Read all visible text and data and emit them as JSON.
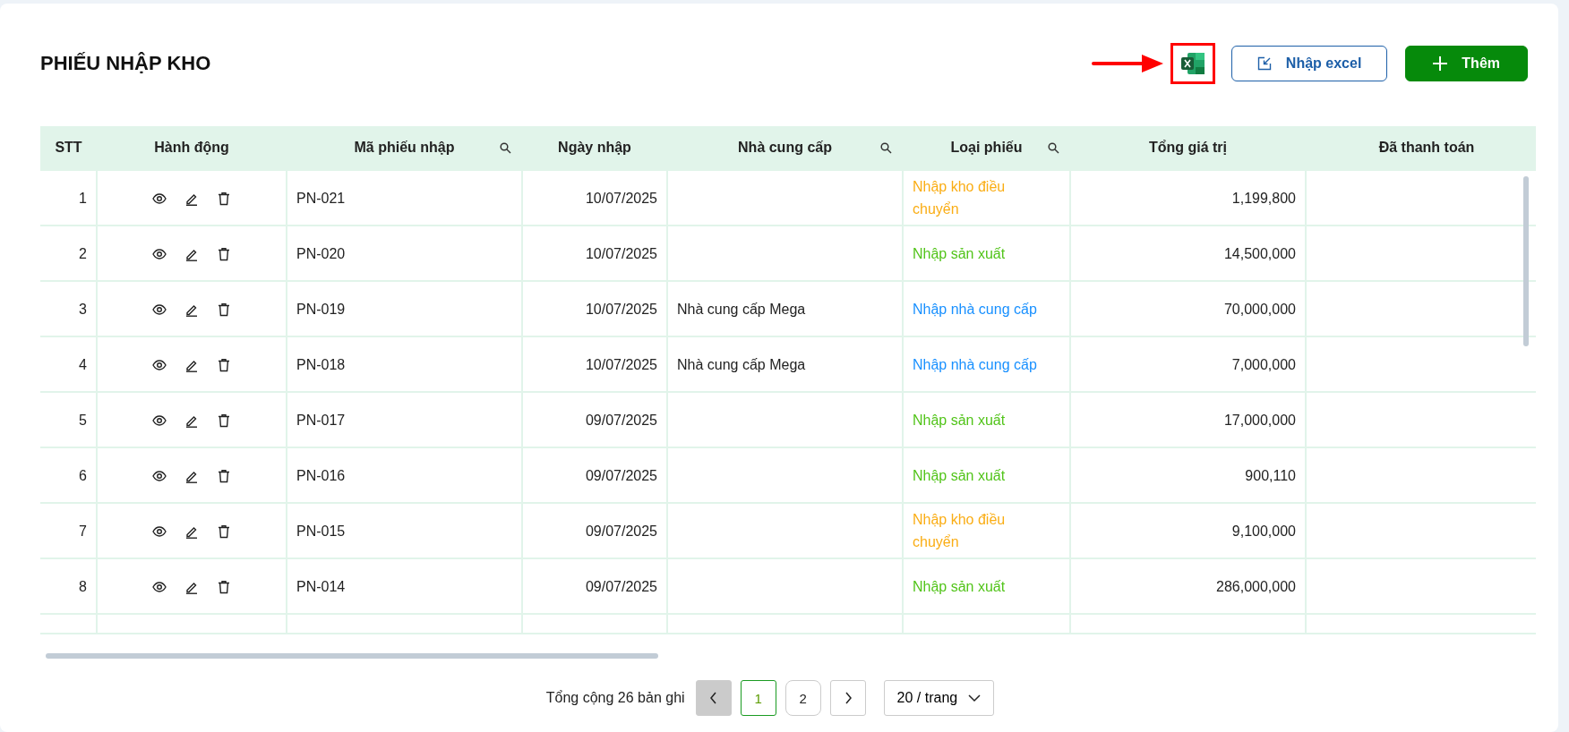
{
  "title": "PHIẾU NHẬP KHO",
  "toolbar": {
    "excel_export_highlighted": true,
    "import_button": "Nhập excel",
    "add_button": "Thêm"
  },
  "table": {
    "columns": [
      {
        "label": "STT",
        "searchable": false
      },
      {
        "label": "Hành động",
        "searchable": false
      },
      {
        "label": "Mã phiếu nhập",
        "searchable": true
      },
      {
        "label": "Ngày nhập",
        "searchable": false
      },
      {
        "label": "Nhà cung cấp",
        "searchable": true
      },
      {
        "label": "Loại phiếu",
        "searchable": true
      },
      {
        "label": "Tổng giá trị",
        "searchable": false
      },
      {
        "label": "Đã thanh toán",
        "searchable": false
      }
    ],
    "rows": [
      {
        "stt": "1",
        "code": "PN-021",
        "date": "10/07/2025",
        "type": "Nhập kho điều chuyển",
        "color": "#faad14",
        "total": "1,199,800"
      },
      {
        "stt": "2",
        "code": "PN-020",
        "date": "10/07/2025",
        "type": "Nhập sản xuất",
        "color": "#52c41a",
        "total": "14,500,000"
      },
      {
        "stt": "3",
        "code": "PN-019",
        "date": "10/07/2025",
        "supplier": "Nhà cung cấp Mega",
        "type": "Nhập nhà cung cấp",
        "color": "#1890ff",
        "total": "70,000,000"
      },
      {
        "stt": "4",
        "code": "PN-018",
        "date": "10/07/2025",
        "supplier": "Nhà cung cấp Mega",
        "type": "Nhập nhà cung cấp",
        "color": "#1890ff",
        "total": "7,000,000"
      },
      {
        "stt": "5",
        "code": "PN-017",
        "date": "09/07/2025",
        "type": "Nhập sản xuất",
        "color": "#52c41a",
        "total": "17,000,000"
      },
      {
        "stt": "6",
        "code": "PN-016",
        "date": "09/07/2025",
        "type": "Nhập sản xuất",
        "color": "#52c41a",
        "total": "900,110"
      },
      {
        "stt": "7",
        "code": "PN-015",
        "date": "09/07/2025",
        "type": "Nhập kho điều chuyển",
        "color": "#faad14",
        "total": "9,100,000"
      },
      {
        "stt": "8",
        "code": "PN-014",
        "date": "09/07/2025",
        "type": "Nhập sản xuất",
        "color": "#52c41a",
        "total": "286,000,000"
      }
    ]
  },
  "pagination": {
    "summary": "Tổng cộng 26 bản ghi",
    "prev_disabled": true,
    "next_disabled": false,
    "pages": [
      {
        "label": "1",
        "selected": true
      },
      {
        "label": "2",
        "selected": false
      }
    ],
    "page_size": "20 / trang"
  }
}
